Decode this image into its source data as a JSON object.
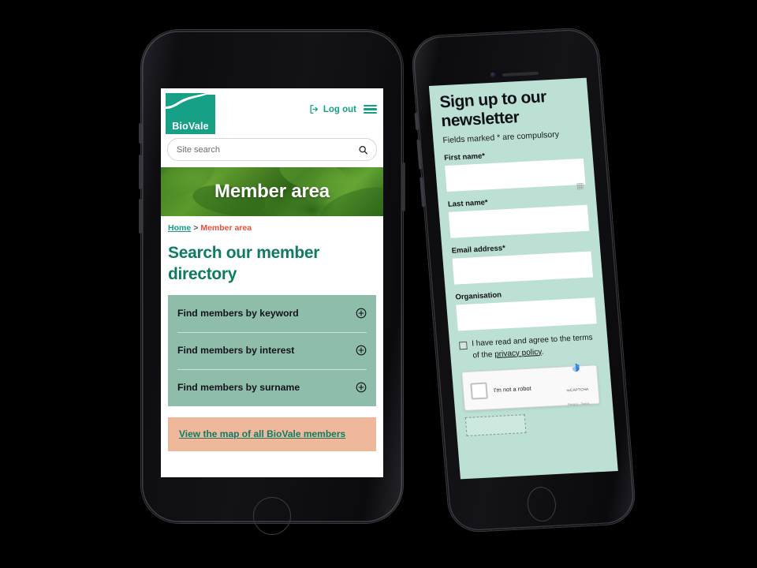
{
  "page": {
    "background_color": "#000000",
    "description": "Two smartphone mockups showing BioVale website screens"
  },
  "phone_left": {
    "device_name": "smartphone-mockup-left",
    "site": {
      "header": {
        "logo": {
          "name": "BioVale",
          "logo_icon": "biovale-wave-logo",
          "color": "#16A085"
        },
        "logout_label": "Log out",
        "logout_icon": "logout-exit-icon",
        "menu_icon": "hamburger-menu-icon"
      },
      "search": {
        "placeholder": "Site search",
        "value": "",
        "icon": "search-magnifier-icon"
      },
      "hero": {
        "title": "Member area",
        "background": "green-leaves-photo"
      },
      "breadcrumb": {
        "home_label": "Home",
        "separator": ">",
        "current_label": "Member area",
        "home_color": "#16A085",
        "current_color": "#E8503A"
      },
      "heading": "Search our member directory",
      "accordion": {
        "background_color": "#8EBDAA",
        "items": [
          {
            "label": "Find members by keyword",
            "icon": "plus-circle-icon"
          },
          {
            "label": "Find members by interest",
            "icon": "plus-circle-icon"
          },
          {
            "label": "Find members by surname",
            "icon": "plus-circle-icon"
          }
        ]
      },
      "cta": {
        "label": "View the map of all BioVale members",
        "background_color": "#F0B89B",
        "text_color": "#0E7B63"
      }
    }
  },
  "phone_right": {
    "device_name": "smartphone-mockup-right",
    "form": {
      "background_color": "#BDE0D4",
      "title": "Sign up to our newsletter",
      "subtitle": "Fields marked * are compulsory",
      "fields": [
        {
          "label": "First name*",
          "value": "",
          "required": true
        },
        {
          "label": "Last name*",
          "value": "",
          "required": true
        },
        {
          "label": "Email address*",
          "value": "",
          "required": true
        },
        {
          "label": "Organisation",
          "value": "",
          "required": false
        }
      ],
      "consent": {
        "text_before": "I have read and agree to the terms of the",
        "link_label": "privacy policy",
        "text_after": ".",
        "checked": false
      },
      "recaptcha": {
        "label": "I'm not a robot",
        "brand": "reCAPTCHA",
        "legal": "Privacy - Terms",
        "logo_icon": "recaptcha-logo-icon"
      }
    }
  }
}
